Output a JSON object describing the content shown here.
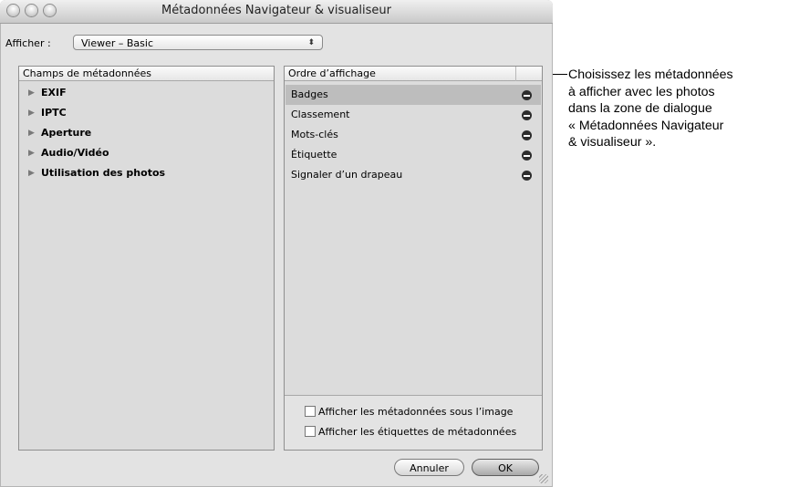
{
  "window": {
    "title": "Métadonnées Navigateur & visualiseur"
  },
  "toolbar": {
    "afficher_label": "Afficher :",
    "preset_value": "Viewer – Basic"
  },
  "left_panel": {
    "header": "Champs de métadonnées",
    "items": [
      {
        "label": "EXIF"
      },
      {
        "label": "IPTC"
      },
      {
        "label": "Aperture"
      },
      {
        "label": "Audio/Vidéo"
      },
      {
        "label": "Utilisation des photos"
      }
    ]
  },
  "right_panel": {
    "header": "Ordre d’affichage",
    "rows": [
      {
        "label": "Badges",
        "selected": true
      },
      {
        "label": "Classement"
      },
      {
        "label": "Mots-clés"
      },
      {
        "label": "Étiquette"
      },
      {
        "label": "Signaler d’un drapeau"
      }
    ],
    "checkbox_1": "Afficher les métadonnées sous l’image",
    "checkbox_2": "Afficher les étiquettes de métadonnées"
  },
  "buttons": {
    "cancel": "Annuler",
    "ok": "OK"
  },
  "callout": {
    "lines": [
      "Choisissez les métadonnées",
      "à afficher avec les photos",
      "dans la zone de dialogue",
      "« Métadonnées Navigateur",
      "& visualiseur »."
    ]
  }
}
